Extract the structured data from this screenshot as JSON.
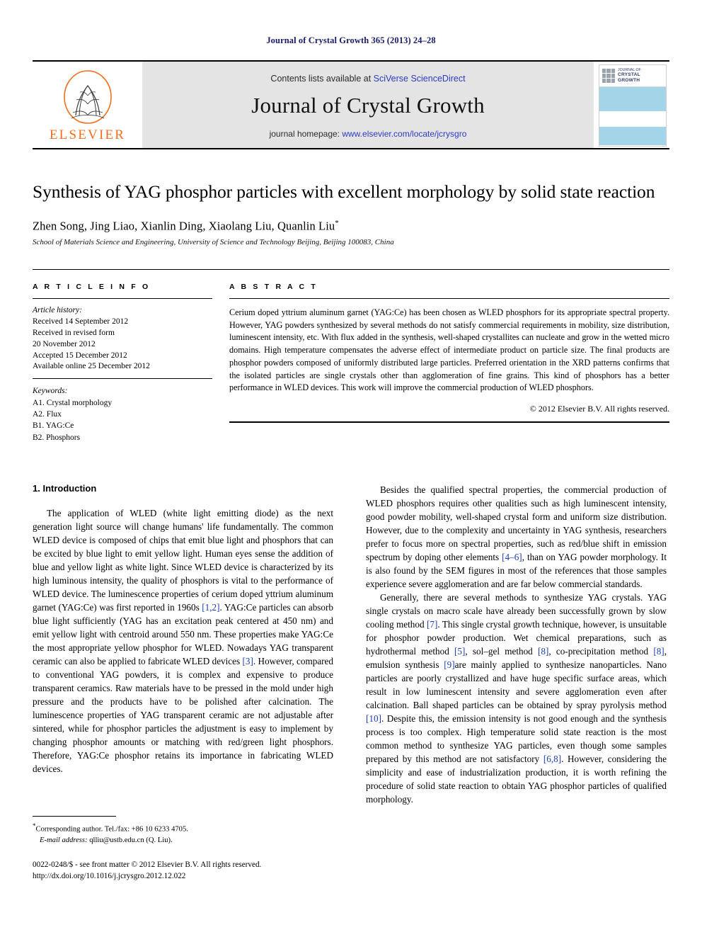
{
  "running_head": "Journal of Crystal Growth 365 (2013) 24–28",
  "masthead": {
    "publisher_name": "ELSEVIER",
    "contents_prefix": "Contents lists available at ",
    "contents_link": "SciVerse ScienceDirect",
    "journal_name": "Journal of Crystal Growth",
    "homepage_prefix": "journal homepage: ",
    "homepage_link": "www.elsevier.com/locate/jcrysgro",
    "cover_kicker": "JOURNAL OF",
    "cover_title_line1": "CRYSTAL",
    "cover_title_line2": "GROWTH"
  },
  "article": {
    "title": "Synthesis of YAG phosphor particles with excellent morphology by solid state reaction",
    "authors": "Zhen Song, Jing Liao, Xianlin Ding, Xiaolang Liu, Quanlin Liu",
    "author_marker": "*",
    "affiliation": "School of Materials Science and Engineering, University of Science and Technology Beijing, Beijing 100083, China"
  },
  "article_info": {
    "heading": "A R T I C L E   I N F O",
    "history_label": "Article history:",
    "history": [
      "Received 14 September 2012",
      "Received in revised form",
      "20 November 2012",
      "Accepted 15 December 2012",
      "Available online 25 December 2012"
    ],
    "keywords_label": "Keywords:",
    "keywords": [
      "A1. Crystal morphology",
      "A2. Flux",
      "B1. YAG:Ce",
      "B2. Phosphors"
    ]
  },
  "abstract": {
    "heading": "A B S T R A C T",
    "text": "Cerium doped yttrium aluminum garnet (YAG:Ce) has been chosen as WLED phosphors for its appropriate spectral property. However, YAG powders synthesized by several methods do not satisfy commercial requirements in mobility, size distribution, luminescent intensity, etc. With flux added in the synthesis, well-shaped crystallites can nucleate and grow in the wetted micro domains. High temperature compensates the adverse effect of intermediate product on particle size. The final products are phosphor powders composed of uniformly distributed large particles. Preferred orientation in the XRD patterns confirms that the isolated particles are single crystals other than agglomeration of fine grains. This kind of phosphors has a better performance in WLED devices. This work will improve the commercial production of WLED phosphors.",
    "copyright": "© 2012 Elsevier B.V. All rights reserved."
  },
  "body": {
    "section_number_title": "1.  Introduction",
    "left_paragraph_1_a": "The application of WLED (white light emitting diode) as the next generation light source will change humans' life fundamentally. The common WLED device is composed of chips that emit blue light and phosphors that can be excited by blue light to emit yellow light. Human eyes sense the addition of blue and yellow light as white light. Since WLED device is characterized by its high luminous intensity, the quality of phosphors is vital to the performance of WLED device. The luminescence properties of cerium doped yttrium aluminum garnet (YAG:Ce) was first reported in 1960s ",
    "left_ref_1": "[1,2]",
    "left_paragraph_1_b": ". YAG:Ce particles can absorb blue light sufficiently (YAG has an excitation peak centered at 450 nm) and emit yellow light with centroid around 550 nm. These properties make YAG:Ce the most appropriate yellow phosphor for WLED. Nowadays YAG transparent ceramic can also be applied to fabricate WLED devices ",
    "left_ref_2": "[3]",
    "left_paragraph_1_c": ". However, compared to conventional YAG powders, it is complex and expensive to produce transparent ceramics. Raw materials have to be pressed in the mold under high pressure and the products have to be polished after calcination. The luminescence properties of YAG transparent ceramic are not adjustable after sintered, while for phosphor particles the adjustment is easy to implement by changing phosphor amounts or matching with red/green light phosphors. Therefore, YAG:Ce phosphor retains its importance in fabricating WLED devices.",
    "right_paragraph_1_a": "Besides the qualified spectral properties, the commercial production of WLED phosphors requires other qualities such as high luminescent intensity, good powder mobility, well-shaped crystal form and uniform size distribution. However, due to the complexity and uncertainty in YAG synthesis, researchers prefer to focus more on spectral properties, such as red/blue shift in emission spectrum by doping other elements ",
    "right_ref_1": "[4–6]",
    "right_paragraph_1_b": ", than on YAG powder morphology. It is also found by the SEM figures in most of the references that those samples experience severe agglomeration and are far below commercial standards.",
    "right_paragraph_2_a": "Generally, there are several methods to synthesize YAG crystals. YAG single crystals on macro scale have already been successfully grown by slow cooling method ",
    "right_ref_2": "[7]",
    "right_paragraph_2_b": ". This single crystal growth technique, however, is unsuitable for phosphor powder production. Wet chemical preparations, such as hydrothermal method ",
    "right_ref_3": "[5]",
    "right_paragraph_2_c": ", sol–gel method ",
    "right_ref_4": "[8]",
    "right_paragraph_2_d": ", co-precipitation method ",
    "right_ref_5": "[8]",
    "right_paragraph_2_e": ", emulsion synthesis ",
    "right_ref_6": "[9]",
    "right_paragraph_2_f": "are mainly applied to synthesize nanoparticles. Nano particles are poorly crystallized and have huge specific surface areas, which result in low luminescent intensity and severe agglomeration even after calcination. Ball shaped particles can be obtained by spray pyrolysis method ",
    "right_ref_7": "[10]",
    "right_paragraph_2_g": ". Despite this, the emission intensity is not good enough and the synthesis process is too complex. High temperature solid state reaction is the most common method to synthesize YAG particles, even though some samples prepared by this method are not satisfactory ",
    "right_ref_8": "[6,8]",
    "right_paragraph_2_h": ". However, considering the simplicity and ease of industrialization production, it is worth refining the procedure of solid state reaction to obtain YAG phosphor particles of qualified morphology."
  },
  "footnote": {
    "marker": "*",
    "corresponding": "Corresponding author. Tel./fax: +86 10 6233 4705.",
    "email_label": "E-mail address:",
    "email_value": " qlliu@ustb.edu.cn (Q. Liu)."
  },
  "footer": {
    "issn_line": "0022-0248/$ - see front matter © 2012 Elsevier B.V. All rights reserved.",
    "doi_line": "http://dx.doi.org/10.1016/j.jcrysgro.2012.12.022"
  },
  "colors": {
    "running_head": "#1a1a6e",
    "link": "#2d3bbf",
    "reference": "#1b3fae",
    "elsevier_orange": "#f06f1e",
    "masthead_bg": "#e4e4e4",
    "cover_band": "#a4d4e8"
  }
}
